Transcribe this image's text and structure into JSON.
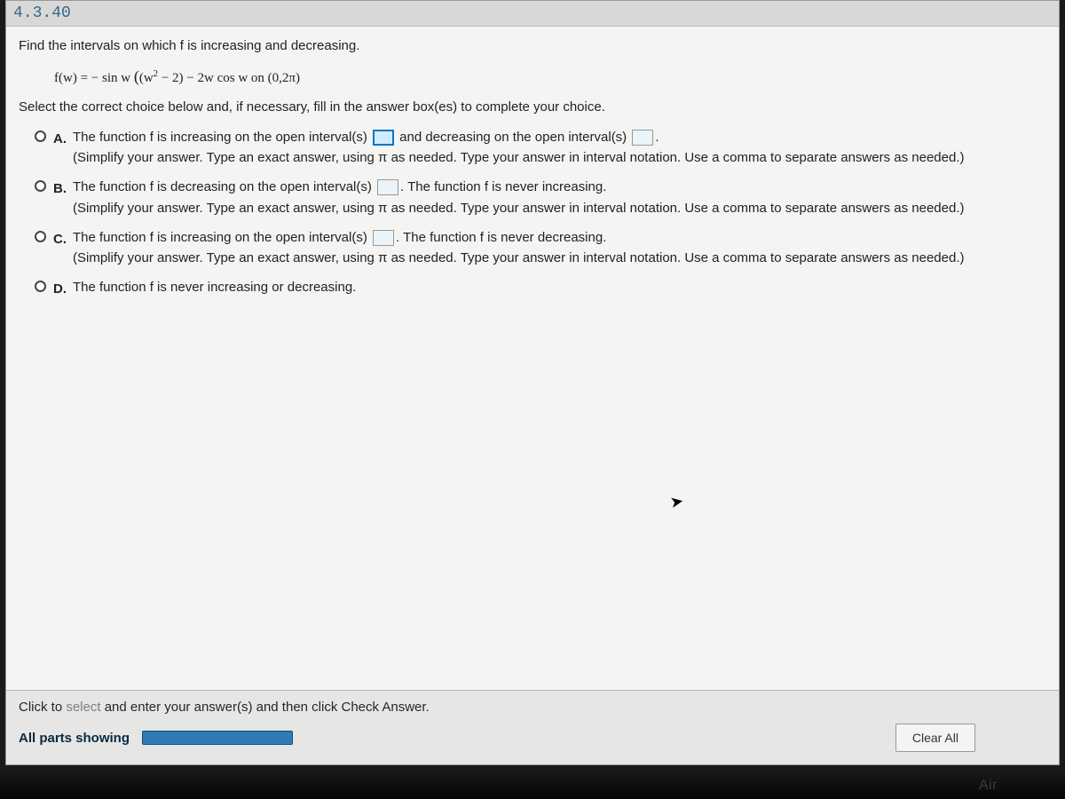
{
  "header": {
    "question_number": "4.3.40"
  },
  "question": {
    "prompt": "Find the intervals on which f is increasing and decreasing.",
    "equation_prefix": "f(w) = − sin w ",
    "equation_paren": "(w",
    "equation_exp": "2",
    "equation_paren_end": " − 2)",
    "equation_suffix": " − 2w cos w on (0,2π)",
    "instruction": "Select the correct choice below and, if necessary, fill in the answer box(es) to complete your choice."
  },
  "options": {
    "a": {
      "label": "A.",
      "text1": "The function f is increasing on the open interval(s) ",
      "text2": " and decreasing on the open interval(s) ",
      "text3": ".",
      "simplify": "(Simplify your answer. Type an exact answer, using π as needed. Type your answer in interval notation. Use a comma to separate answers as needed.)"
    },
    "b": {
      "label": "B.",
      "text1": "The function f is decreasing on the open interval(s) ",
      "text2": ". The function f is never increasing.",
      "simplify": "(Simplify your answer. Type an exact answer, using π as needed. Type your answer in interval notation. Use a comma to separate answers as needed.)"
    },
    "c": {
      "label": "C.",
      "text1": "The function f is increasing on the open interval(s) ",
      "text2": ". The function f is never decreasing.",
      "simplify": "(Simplify your answer. Type an exact answer, using π as needed. Type your answer in interval notation. Use a comma to separate answers as needed.)"
    },
    "d": {
      "label": "D.",
      "text": "The function f is never increasing or decreasing."
    }
  },
  "footer": {
    "hint_prefix": "Click to ",
    "hint_select": "select",
    "hint_suffix": " and enter your answer(s) and then click Check Answer.",
    "all_parts": "All parts showing",
    "clear_button": "Clear All"
  },
  "device": {
    "label": "Air"
  }
}
